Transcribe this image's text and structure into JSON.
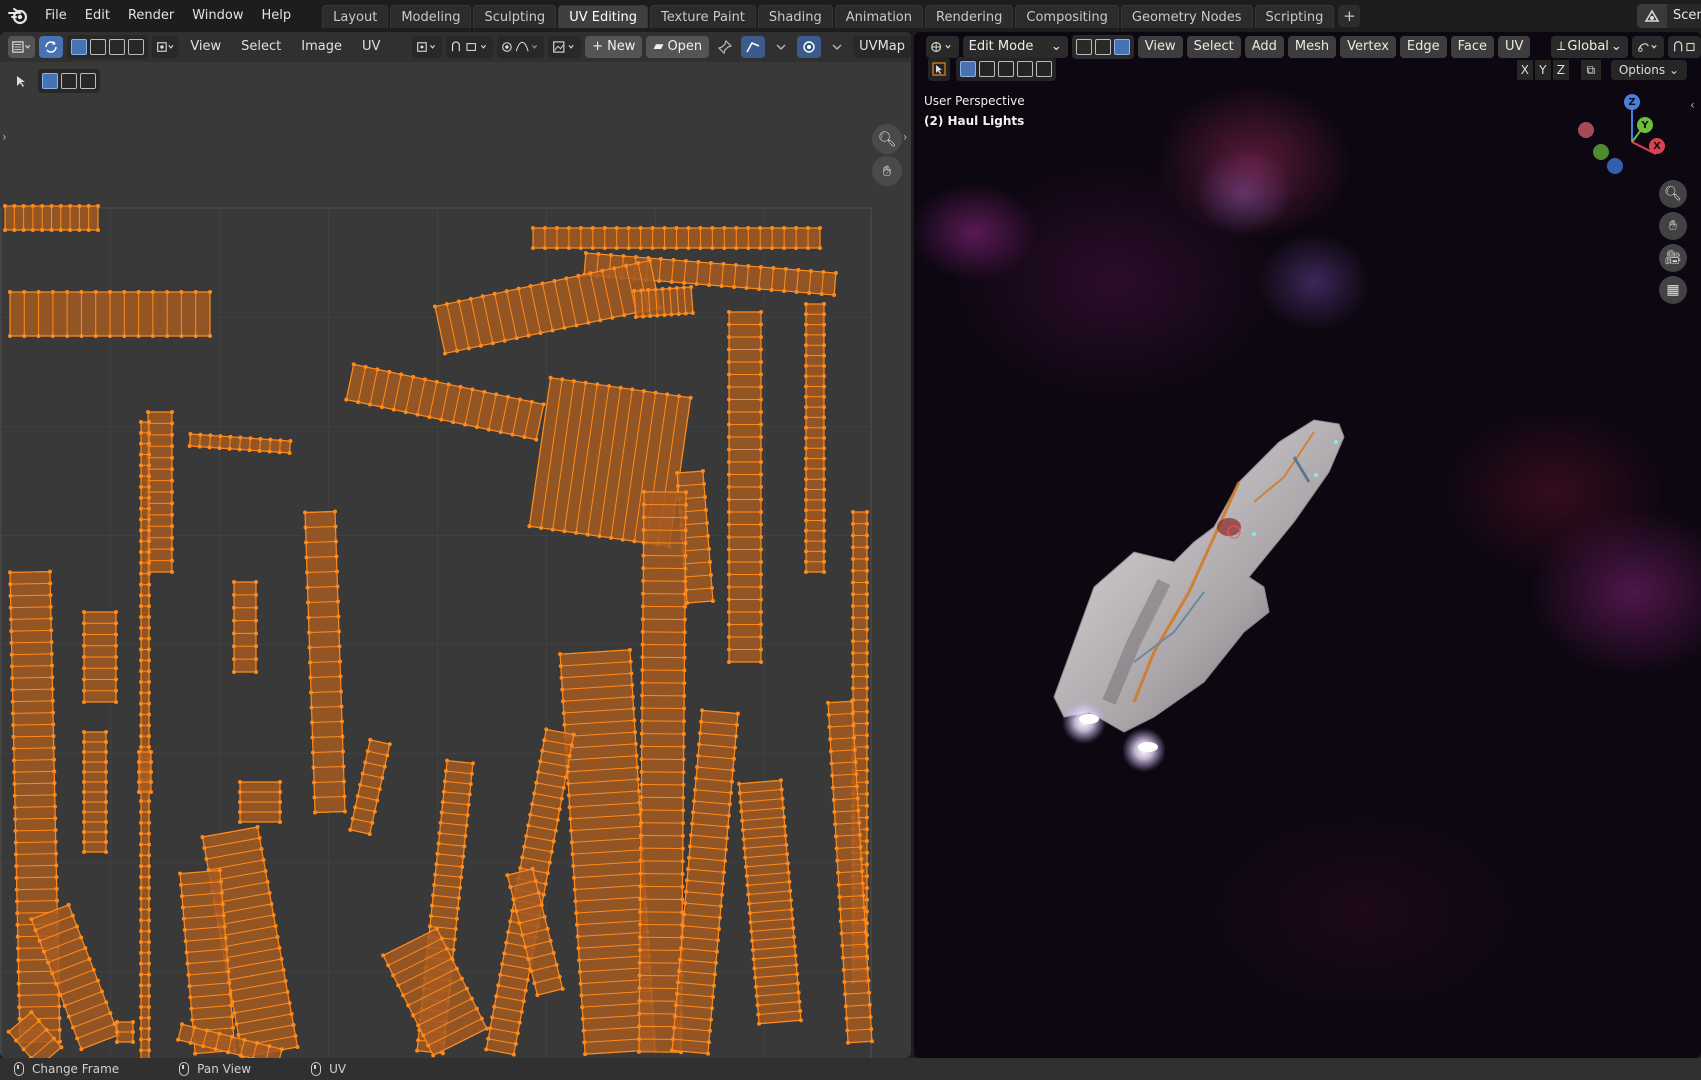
{
  "topbar": {
    "menus": [
      "File",
      "Edit",
      "Render",
      "Window",
      "Help"
    ],
    "workspaces": [
      "Layout",
      "Modeling",
      "Sculpting",
      "UV Editing",
      "Texture Paint",
      "Shading",
      "Animation",
      "Rendering",
      "Compositing",
      "Geometry Nodes",
      "Scripting"
    ],
    "active_workspace": "UV Editing",
    "add_tab": "+",
    "scene_label": "Scene"
  },
  "uv_editor": {
    "menus": [
      "View",
      "Select",
      "Image",
      "UV"
    ],
    "new_label": "New",
    "open_label": "Open",
    "uvmap_label": "UVMap"
  },
  "viewport": {
    "mode": "Edit Mode",
    "menus": [
      "View",
      "Select",
      "Add",
      "Mesh",
      "Vertex",
      "Edge",
      "Face",
      "UV"
    ],
    "orientation": "Global",
    "perspective_label": "User Perspective",
    "object_label": "(2) Haul Lights",
    "axis_x": "X",
    "axis_y": "Y",
    "axis_z": "Z",
    "options_label": "Options"
  },
  "statusbar": {
    "items": [
      "Change Frame",
      "Pan View",
      "UV"
    ]
  },
  "colors": {
    "uv_island_fill": "#a55a22",
    "uv_island_edge": "#ff8a1c",
    "accent_blue": "#4772b3"
  }
}
